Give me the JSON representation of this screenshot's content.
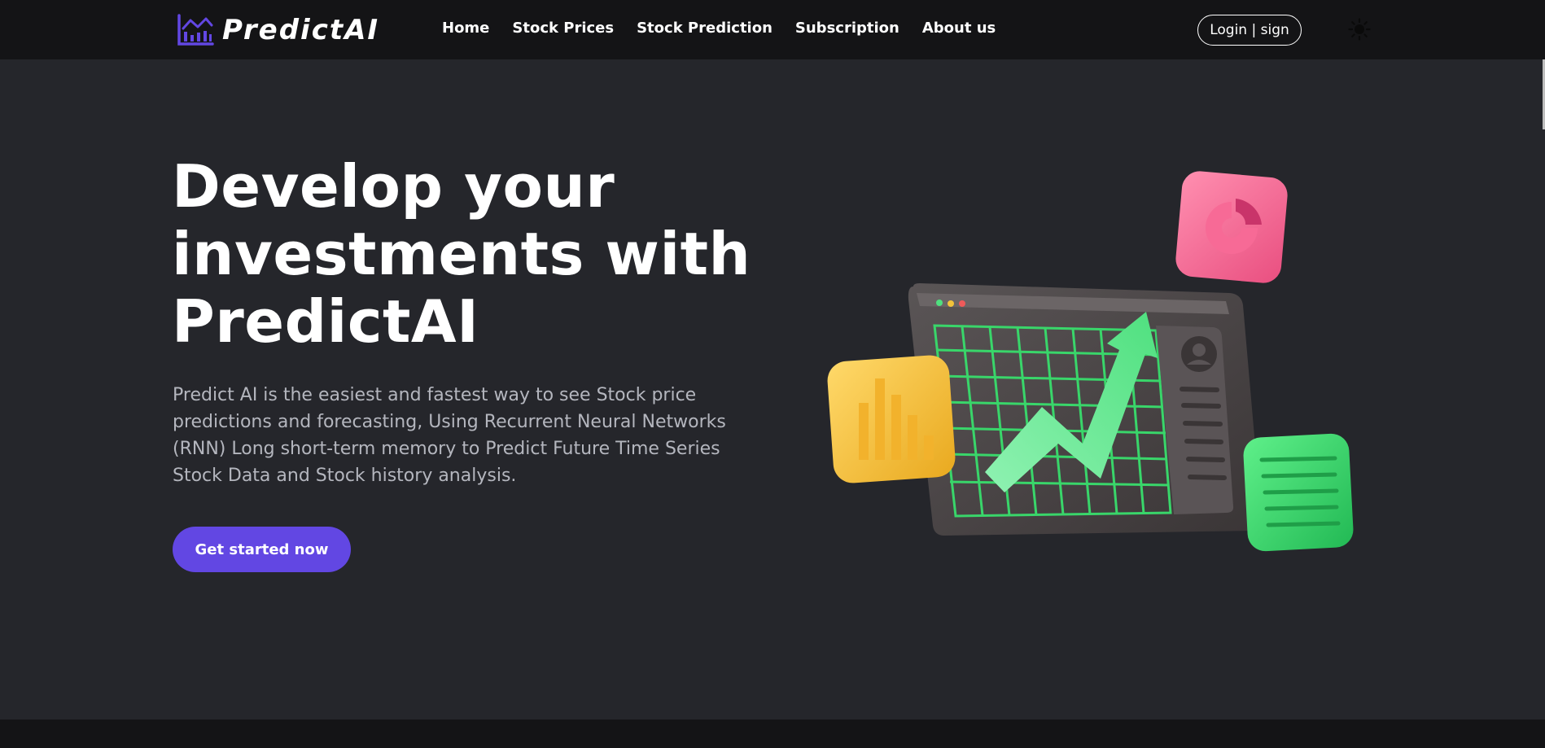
{
  "brand": {
    "name": "PredictAI",
    "accent": "#6247e3"
  },
  "nav": {
    "links": [
      "Home",
      "Stock Prices",
      "Stock Prediction",
      "Subscription",
      "About us"
    ],
    "login_label": "Login | sign"
  },
  "theme_toggle": {
    "icon": "sun-icon"
  },
  "hero": {
    "title": "Develop your investments with PredictAI",
    "description": "Predict AI is the easiest and fastest way to see Stock price predictions and forecasting, Using Recurrent Neural Networks (RNN) Long short-term memory to Predict Future Time Series Stock Data and Stock history analysis.",
    "cta_label": "Get started now"
  },
  "colors": {
    "page_bg": "#25262b",
    "nav_bg": "#141416",
    "button": "#6247e3",
    "muted_text": "#b4b6be"
  }
}
